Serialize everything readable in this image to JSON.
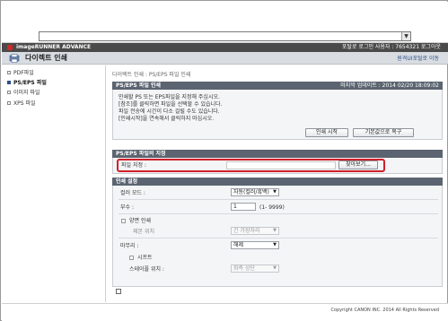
{
  "browser": {
    "address_value": ""
  },
  "header": {
    "brand": "imageRUNNER ADVANCE",
    "login_info": "포탈로  로그인 사용자 : 7654321  로그아웃",
    "title": "다이렉트 인쇄",
    "portal_link": "원격UI포털로 이동"
  },
  "sidebar": {
    "items": [
      {
        "label": "PDF파일"
      },
      {
        "label": "PS/EPS 파일"
      },
      {
        "label": "이미지 파일"
      },
      {
        "label": "XPS 파일"
      }
    ]
  },
  "breadcrumb": "다이렉트 인쇄 : PS/EPS 파일 인쇄",
  "print_section": {
    "title": "PS/EPS 파일 인쇄",
    "last_updated": "마지막 업데이트 : 2014 02/20 18:09:02",
    "lines": [
      "인쇄할 PS 또는 EPS파일을 지정해 주십시오.",
      "[참조]를 클릭하면 파일을 선택할 수 있습니다.",
      "파일 전송에 시간이 다소 걸릴 수도 있습니다.",
      "[인쇄시작]을 연속해서 클릭하지 마십시오."
    ],
    "start_button": "인쇄 시작",
    "reset_button": "기본값으로 복구"
  },
  "file_section": {
    "title": "PS/EPS 파일의 지정",
    "file_label": "파일 지정 :",
    "file_value": "",
    "browse_button": "찾아보기..."
  },
  "settings_section": {
    "title": "인쇄 설정",
    "color_mode_label": "컬러 모드 :",
    "color_mode_value": "자동(컬러/흑백)",
    "copies_label": "부수 :",
    "copies_value": "1",
    "copies_range": "(1- 9999)",
    "duplex_label": "양면 인쇄",
    "binding_label": "제본 위치",
    "binding_value": "긴 가장자리",
    "finishing_label": "마무리 :",
    "finishing_value": "해제",
    "shift_label": "시프트",
    "staple_label": "스테이플 위치 :",
    "staple_value": "좌측 상단"
  },
  "footer": {
    "copyright": "Copyright CANON INC. 2014 All Rights Reserved"
  },
  "colors": {
    "brand_bar": "#4a4a4a",
    "section_head": "#5b6470",
    "highlight": "#d0202a",
    "link": "#2b4f8a"
  },
  "icons": [
    "dropdown-arrow-icon",
    "canon-logo-icon",
    "direct-print-icon",
    "sidebar-bullet-icon",
    "checkbox-icon",
    "page-top-icon"
  ]
}
